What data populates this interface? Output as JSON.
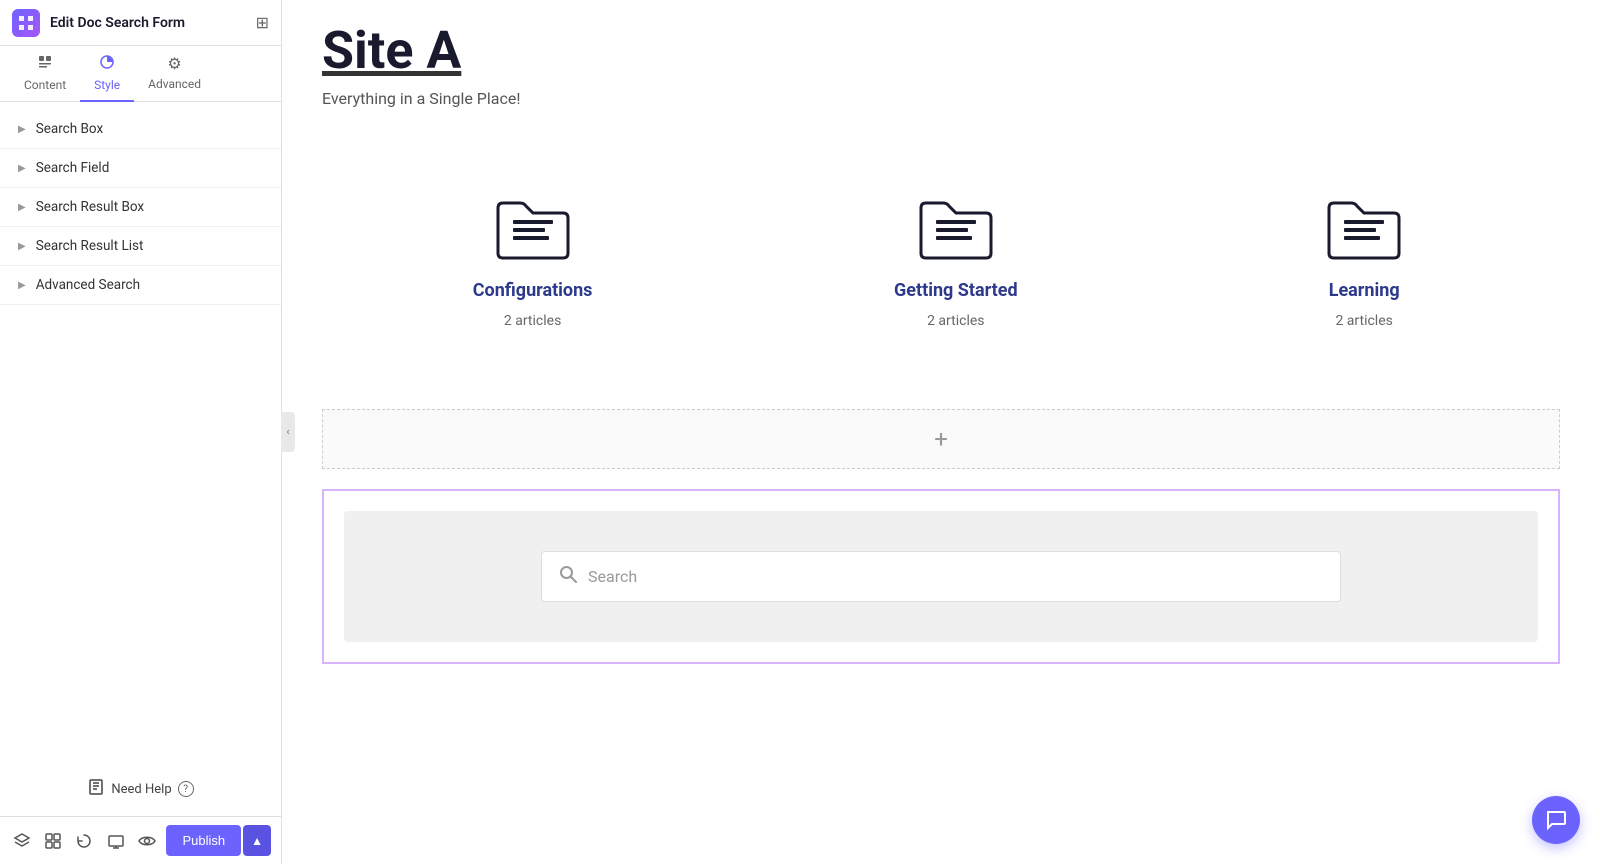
{
  "header": {
    "title": "Edit Doc Search Form",
    "icon": "≡"
  },
  "tabs": [
    {
      "id": "content",
      "label": "Content",
      "icon": "◧",
      "active": false
    },
    {
      "id": "style",
      "label": "Style",
      "icon": "◑",
      "active": true
    },
    {
      "id": "advanced",
      "label": "Advanced",
      "icon": "⚙",
      "active": false
    }
  ],
  "menu": {
    "items": [
      {
        "id": "search-box",
        "label": "Search Box"
      },
      {
        "id": "search-field",
        "label": "Search Field"
      },
      {
        "id": "search-result-box",
        "label": "Search Result Box"
      },
      {
        "id": "search-result-list",
        "label": "Search Result List"
      },
      {
        "id": "advanced-search",
        "label": "Advanced Search"
      }
    ]
  },
  "need_help": {
    "label": "Need Help",
    "icon": "?"
  },
  "toolbar": {
    "publish_label": "Publish",
    "icons": [
      "layers",
      "stack",
      "history",
      "responsive",
      "view",
      "eye"
    ]
  },
  "page": {
    "site_title": "Site A",
    "subtitle": "Everything in a Single Place!",
    "categories": [
      {
        "id": "configurations",
        "title": "Configurations",
        "articles": "2 articles"
      },
      {
        "id": "getting-started",
        "title": "Getting Started",
        "articles": "2 articles"
      },
      {
        "id": "learning",
        "title": "Learning",
        "articles": "2 articles"
      }
    ],
    "search_placeholder": "Search"
  },
  "colors": {
    "accent": "#6c63ff",
    "title_color": "#2d3a8c",
    "highlight_border": "#d8b4fe"
  }
}
